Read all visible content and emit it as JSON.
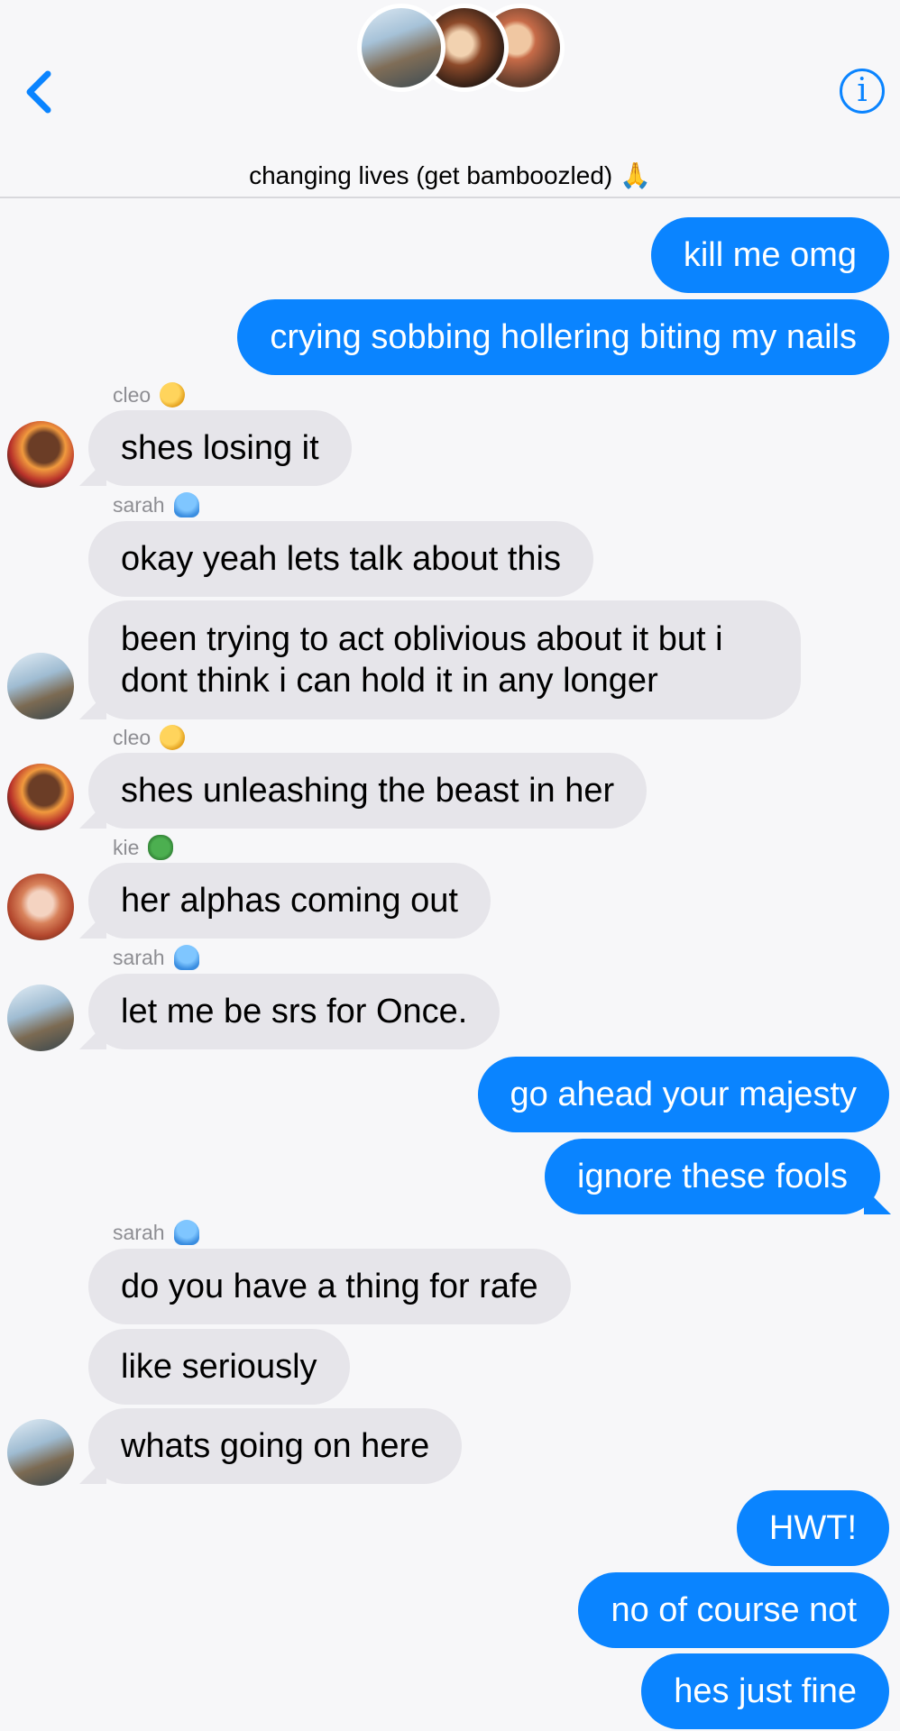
{
  "header": {
    "title": "changing lives (get bamboozled) 🙏",
    "back_icon": "chevron-left-icon",
    "info_icon": "info-icon",
    "info_glyph": "i",
    "accent_color": "#0a84ff"
  },
  "participants": [
    "sarah",
    "cleo",
    "kie"
  ],
  "senders": {
    "cleo": "cleo",
    "sarah": "sarah",
    "kie": "kie"
  },
  "messages": [
    {
      "from": "me",
      "text": "kill me omg"
    },
    {
      "from": "me",
      "text": "crying sobbing hollering biting my nails"
    },
    {
      "from": "cleo",
      "text": "shes losing it"
    },
    {
      "from": "sarah",
      "text": "okay yeah lets talk about this"
    },
    {
      "from": "sarah",
      "text": "been trying to act oblivious about it but i dont think i can hold it in any longer"
    },
    {
      "from": "cleo",
      "text": "shes unleashing the beast in her"
    },
    {
      "from": "kie",
      "text": "her alphas coming out"
    },
    {
      "from": "sarah",
      "text": "let me be srs for Once."
    },
    {
      "from": "me",
      "text": "go ahead your majesty"
    },
    {
      "from": "me",
      "text": "ignore these fools"
    },
    {
      "from": "sarah",
      "text": "do you have a thing for rafe"
    },
    {
      "from": "sarah",
      "text": "like seriously"
    },
    {
      "from": "sarah",
      "text": "whats going on here"
    },
    {
      "from": "me",
      "text": "HWT!"
    },
    {
      "from": "me",
      "text": "no of course not"
    },
    {
      "from": "me",
      "text": "hes just fine"
    }
  ],
  "colors": {
    "sent_bubble": "#0a84ff",
    "received_bubble": "#e6e5ea",
    "background": "#f7f7f9"
  }
}
